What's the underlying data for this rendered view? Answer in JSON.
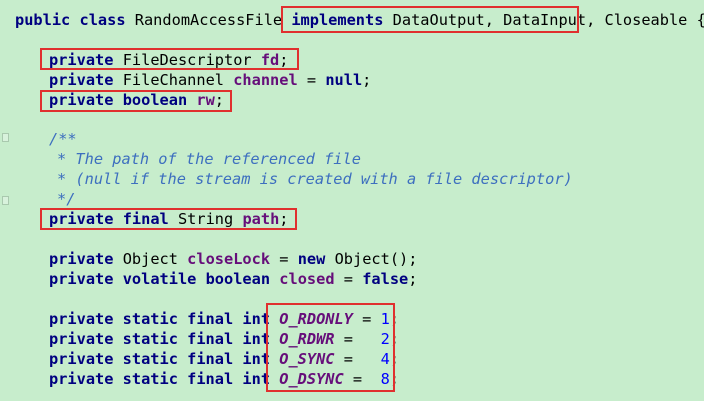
{
  "code": {
    "l1": {
      "kw1": "public",
      "kw2": "class",
      "name": "RandomAccessFile",
      "kw3": "implements",
      "ifaces": "DataOutput, DataInput,",
      "rest": "Closeable {"
    },
    "l2": {
      "kw": "private",
      "type": "FileDescriptor",
      "field": "fd",
      "end": ";"
    },
    "l3": {
      "kw": "private",
      "type": "FileChannel",
      "field": "channel",
      "eq": " = ",
      "val": "null",
      "end": ";"
    },
    "l4": {
      "kw1": "private",
      "kw2": "boolean",
      "field": "rw",
      "end": ";"
    },
    "c1": "/**",
    "c2": "* The path of the referenced file",
    "c3": "* (null if the stream is created with a file descriptor)",
    "c4": "*/",
    "l5": {
      "kw1": "private",
      "kw2": "final",
      "type": "String",
      "field": "path",
      "end": ";"
    },
    "l6": {
      "kw": "private",
      "type": "Object",
      "field": "closeLock",
      "eq": " = ",
      "kwnew": "new",
      "rest": "Object();"
    },
    "l7": {
      "kw1": "private",
      "kw2": "volatile",
      "kw3": "boolean",
      "field": "closed",
      "eq": " = ",
      "val": "false",
      "end": ";"
    },
    "consts": [
      {
        "mods": "private static final int",
        "name": "O_RDONLY",
        "eq": " = ",
        "pad": "",
        "num": "1",
        "end": ";"
      },
      {
        "mods": "private static final int",
        "name": "O_RDWR",
        "eq": " =   ",
        "pad": "",
        "num": "2",
        "end": ";"
      },
      {
        "mods": "private static final int",
        "name": "O_SYNC",
        "eq": " =   ",
        "pad": "",
        "num": "4",
        "end": ";"
      },
      {
        "mods": "private static final int",
        "name": "O_DSYNC",
        "eq": " =  ",
        "pad": "",
        "num": "8",
        "end": ";"
      }
    ]
  },
  "colors": {
    "background": "#c7edcc",
    "keyword": "#000080",
    "field": "#660e7a",
    "number": "#0000ff",
    "comment": "#3d6fbf",
    "highlight_box": "#e0302e"
  }
}
